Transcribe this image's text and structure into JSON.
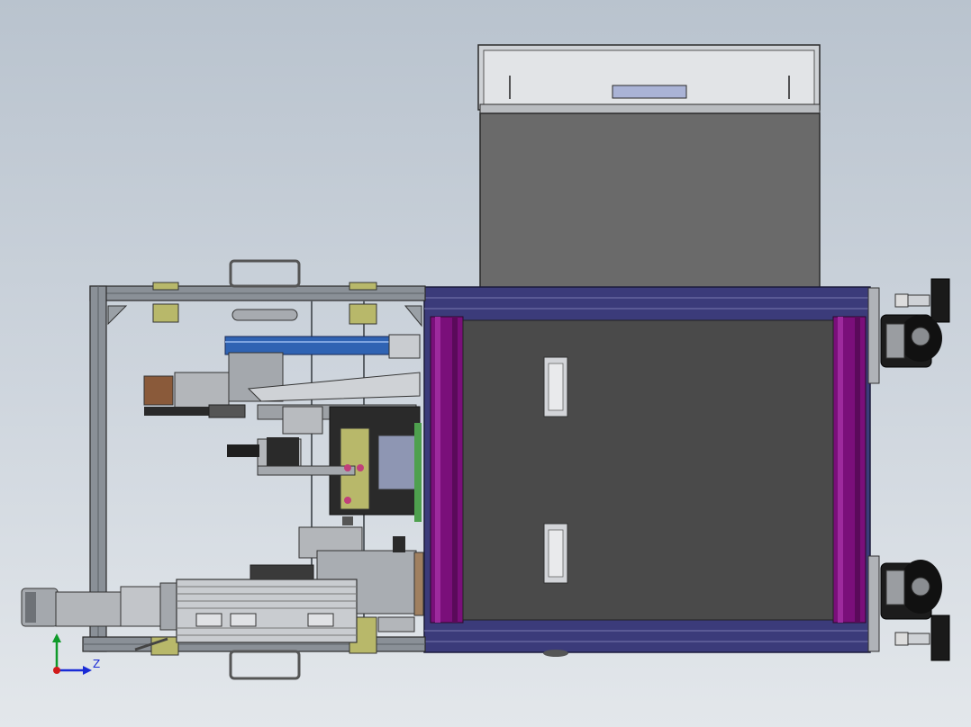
{
  "scene": {
    "view": "top",
    "colors": {
      "background_top": "#b9c3ce",
      "background_bottom": "#e3e7eb",
      "frame_steel": "#7d848b",
      "panel_dark": "#4a4a4a",
      "hopper_gray": "#6a6a6a",
      "frame_navy": "#3b3b7a",
      "accent_magenta": "#7a0f7a",
      "rail_blue": "#2f63b3",
      "motor_gray": "#b6b8bb",
      "bracket_olive": "#b8b86a",
      "brown_block": "#8a5a3a",
      "wheel_black": "#1a1a1a"
    }
  },
  "triad": {
    "x_axis_label": "Z",
    "x_color": "#1a2bd6",
    "y_color": "#0f9a2a",
    "origin_color": "#d11a1a"
  }
}
